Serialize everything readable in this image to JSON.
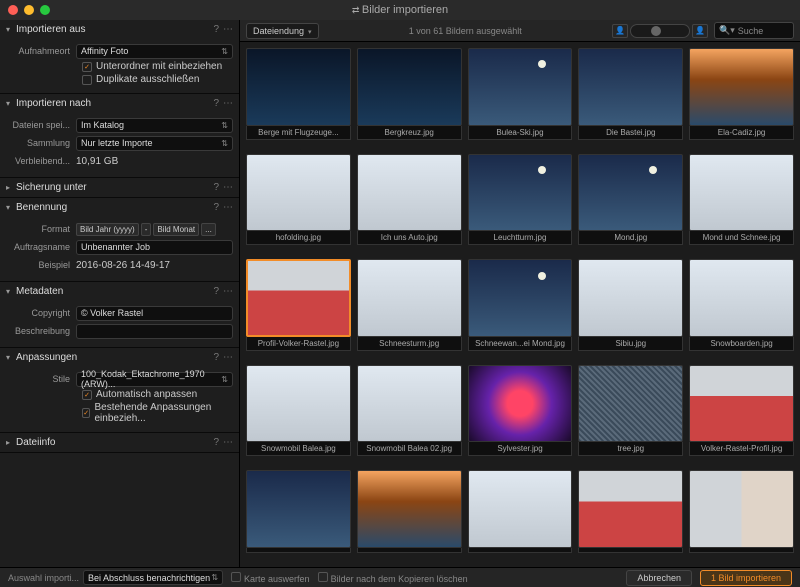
{
  "window": {
    "title": "Bilder importieren"
  },
  "sidebar": {
    "sections": {
      "import_from": {
        "title": "Importieren aus",
        "location_label": "Aufnahmeort",
        "location_value": "Affinity Foto",
        "subfolders_label": "Unterordner mit einbeziehen",
        "duplicates_label": "Duplikate ausschließen",
        "subfolders_checked": true,
        "duplicates_checked": false
      },
      "import_to": {
        "title": "Importieren nach",
        "save_label": "Dateien spei...",
        "save_value": "Im Katalog",
        "collection_label": "Sammlung",
        "collection_value": "Nur letzte Importe",
        "remaining_label": "Verbleibend...",
        "remaining_value": "10,91 GB"
      },
      "backup": {
        "title": "Sicherung unter"
      },
      "naming": {
        "title": "Benennung",
        "format_label": "Format",
        "tokens": [
          "Bild Jahr (yyyy)",
          "-",
          "Bild Monat"
        ],
        "more": "...",
        "job_label": "Auftragsname",
        "job_value": "Unbenannter Job",
        "example_label": "Beispiel",
        "example_value": "2016-08-26 14-49-17"
      },
      "metadata": {
        "title": "Metadaten",
        "copyright_label": "Copyright",
        "copyright_value": "© Volker Rastel",
        "desc_label": "Beschreibung",
        "desc_value": ""
      },
      "adjustments": {
        "title": "Anpassungen",
        "style_label": "Stile",
        "style_value": "100_Kodak_Ektachrome_1970 (ARW)...",
        "auto_label": "Automatisch anpassen",
        "existing_label": "Bestehende Anpassungen einbezieh...",
        "auto_checked": true,
        "existing_checked": true
      },
      "fileinfo": {
        "title": "Dateiinfo"
      }
    }
  },
  "toolbar": {
    "sort_label": "Dateiendung",
    "status": "1 von 61 Bildern ausgewählt",
    "search_placeholder": "Suche"
  },
  "thumbnails": [
    {
      "label": "Berge mit Flugzeuge...",
      "variant": "sky-dark"
    },
    {
      "label": "Bergkreuz.jpg",
      "variant": "sky-dark"
    },
    {
      "label": "Bulea-Ski.jpg",
      "variant": "sky-moon moon-dot"
    },
    {
      "label": "Die Bastei.jpg",
      "variant": "sky-moon"
    },
    {
      "label": "Ela-Cadiz.jpg",
      "variant": "sky-sunset"
    },
    {
      "label": "hofolding.jpg",
      "variant": "snow"
    },
    {
      "label": "Ich uns Auto.jpg",
      "variant": "snow"
    },
    {
      "label": "Leuchtturm.jpg",
      "variant": "sky-moon moon-dot"
    },
    {
      "label": "Mond.jpg",
      "variant": "sky-moon moon-dot"
    },
    {
      "label": "Mond und Schnee.jpg",
      "variant": "snow"
    },
    {
      "label": "Profil-Volker-Rastel.jpg",
      "variant": "face-red",
      "selected": true
    },
    {
      "label": "Schneesturm.jpg",
      "variant": "snow"
    },
    {
      "label": "Schneewan...ei Mond.jpg",
      "variant": "sky-moon moon-dot"
    },
    {
      "label": "Sibiu.jpg",
      "variant": "snow"
    },
    {
      "label": "Snowboarden.jpg",
      "variant": "snow"
    },
    {
      "label": "Snowmobil Balea.jpg",
      "variant": "snow"
    },
    {
      "label": "Snowmobil Balea 02.jpg",
      "variant": "snow"
    },
    {
      "label": "Sylvester.jpg",
      "variant": "fire"
    },
    {
      "label": "tree.jpg",
      "variant": "pattern"
    },
    {
      "label": "Volker-Rastel-Profil.jpg",
      "variant": "face-red"
    },
    {
      "label": "",
      "variant": "sky-moon"
    },
    {
      "label": "",
      "variant": "sky-sunset"
    },
    {
      "label": "",
      "variant": "snow"
    },
    {
      "label": "",
      "variant": "face-red"
    },
    {
      "label": "",
      "variant": "face-pair"
    }
  ],
  "footer": {
    "selection_label": "Auswahl importi...",
    "notify_value": "Bei Abschluss benachrichtigen",
    "eject_label": "Karte auswerfen",
    "delete_label": "Bilder nach dem Kopieren löschen",
    "cancel_label": "Abbrechen",
    "import_label": "1 Bild importieren"
  }
}
